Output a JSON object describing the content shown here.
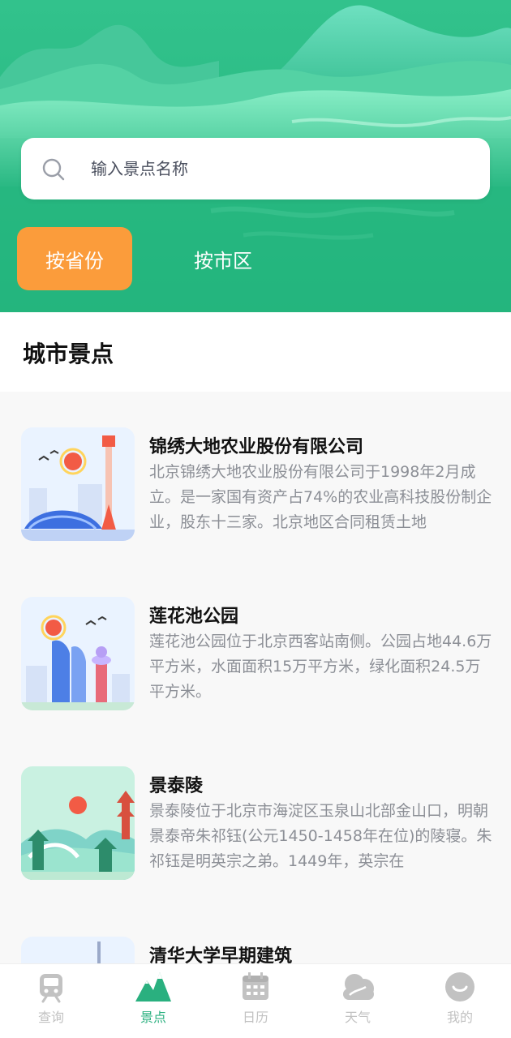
{
  "search": {
    "placeholder": "输入景点名称"
  },
  "filter_tabs": {
    "province": "按省份",
    "district": "按市区"
  },
  "section": {
    "title": "城市景点"
  },
  "spots": [
    {
      "title": "锦绣大地农业股份有限公司",
      "desc": "北京锦绣大地农业股份有限公司于1998年2月成立。是一家国有资产占74%的农业高科技股份制企业，股东十三家。北京地区合同租赁土地"
    },
    {
      "title": "莲花池公园",
      "desc": "莲花池公园位于北京西客站南侧。公园占地44.6万平方米，水面面积15万平方米，绿化面积24.5万平方米。"
    },
    {
      "title": "景泰陵",
      "desc": "景泰陵位于北京市海淀区玉泉山北部金山口，明朝景泰帝朱祁钰(公元1450-1458年在位)的陵寝。朱祁钰是明英宗之弟。1449年，英宗在"
    },
    {
      "title": "清华大学早期建筑",
      "desc": ""
    }
  ],
  "tabbar": [
    {
      "label": "查询",
      "icon": "train-icon"
    },
    {
      "label": "景点",
      "icon": "mountain-icon"
    },
    {
      "label": "日历",
      "icon": "calendar-icon"
    },
    {
      "label": "天气",
      "icon": "cloud-icon"
    },
    {
      "label": "我的",
      "icon": "profile-icon"
    }
  ],
  "colors": {
    "primary": "#25b57e",
    "accent": "#fb9c3b",
    "active": "#2ab07f",
    "inactive": "#c2c2c2"
  }
}
